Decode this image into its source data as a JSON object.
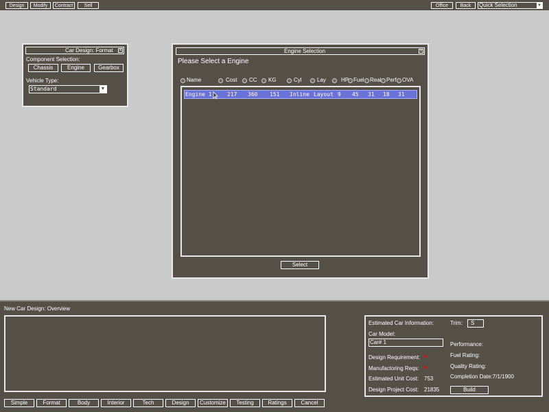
{
  "top_bar": {
    "left_buttons": [
      "Design",
      "Modify",
      "Contract",
      "Sell"
    ],
    "office_label": "Office",
    "back_label": "Back",
    "quick_selection": "Quick Selection"
  },
  "format_window": {
    "title": "Car Design: Format",
    "component_label": "Component Selection:",
    "buttons": [
      "Chassis",
      "Engine",
      "Gearbox"
    ],
    "vehicle_type_label": "Vehicle Type:",
    "vehicle_type_value": "Standard"
  },
  "engine_window": {
    "title": "Engine Selection",
    "heading": "Please Select a Engine",
    "columns": [
      "Name",
      "Cost",
      "CC",
      "KG",
      "Cyl",
      "Lay",
      "HP",
      "Fuel",
      "Real",
      "Perf",
      "OVA"
    ],
    "rows": [
      [
        "Engine 1",
        "217",
        "360",
        "151",
        "Inline",
        "Layout",
        "9",
        "45",
        "31",
        "18",
        "31"
      ]
    ],
    "select_label": "Select"
  },
  "overview": {
    "title": "New Car Design: Overview",
    "bottom_buttons": [
      "Simple",
      "Format",
      "Body",
      "Interior",
      "Tech",
      "Design",
      "Customize",
      "Testing",
      "Ratings",
      "Cancel"
    ],
    "info": {
      "estimated_info_label": "Estimated Car Information:",
      "trim_label": "Trim:",
      "trim_value": "S",
      "car_model_label": "Car Model:",
      "car_model_value": "Car# 1",
      "performance_label": "Performance:",
      "design_req_label": "Design Requirement:",
      "fuel_rating_label": "Fuel Rating:",
      "manufacturing_label": "Manufactoring Reqs:",
      "quality_rating_label": "Quality Rating:",
      "unit_cost_label": "Estimated Unit Cost:",
      "unit_cost_value": "753",
      "completion_label": "Completion Date:7/1/1900",
      "project_cost_label": "Design Project Cost:",
      "project_cost_value": "21835",
      "build_label": "Build"
    }
  },
  "colors": {
    "panel": "#545048",
    "background": "#cacaca",
    "highlight": "#6a72d8",
    "alert": "#c81a1a"
  }
}
